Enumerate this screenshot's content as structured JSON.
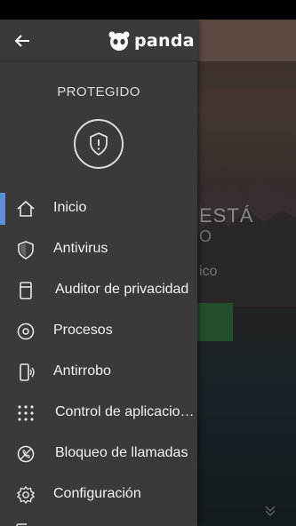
{
  "brand": {
    "logo_text": "panda"
  },
  "drawer": {
    "status": "PROTEGIDO",
    "items": [
      {
        "label": "Inicio",
        "icon": "home-icon",
        "active": true
      },
      {
        "label": "Antivirus",
        "icon": "shield-icon",
        "active": false
      },
      {
        "label": "Auditor de privacidad",
        "icon": "privacy-auditor-icon",
        "active": false
      },
      {
        "label": "Procesos",
        "icon": "processes-icon",
        "active": false
      },
      {
        "label": "Antirrobo",
        "icon": "anti-theft-icon",
        "active": false
      },
      {
        "label": "Control de aplicaciones",
        "icon": "app-control-icon",
        "active": false
      },
      {
        "label": "Bloqueo de llamadas",
        "icon": "call-blocking-icon",
        "active": false
      },
      {
        "label": "Configuración",
        "icon": "settings-icon",
        "active": false
      }
    ]
  },
  "background": {
    "text_1": "ESTÁ",
    "text_2": "O",
    "text_3": "ico"
  },
  "colors": {
    "drawer_bg": "#3a3a3a",
    "active_indicator": "#5b8fd6",
    "button_green": "#2f6a3d"
  }
}
